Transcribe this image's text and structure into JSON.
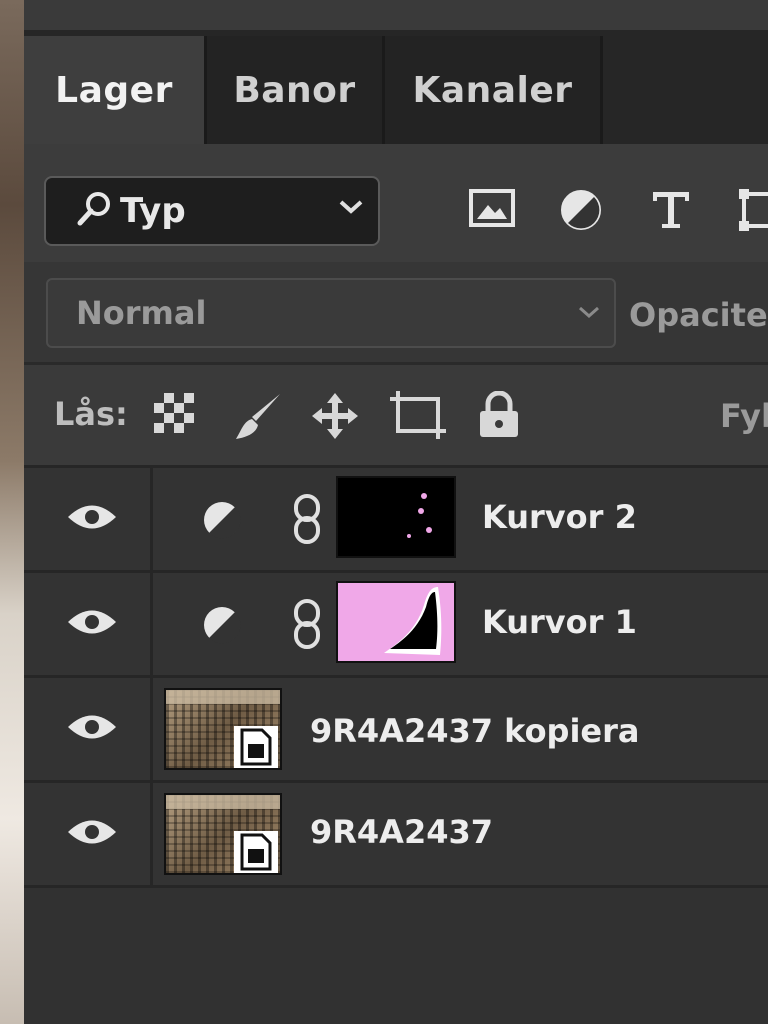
{
  "tabs": [
    {
      "label": "Lager",
      "active": true
    },
    {
      "label": "Banor",
      "active": false
    },
    {
      "label": "Kanaler",
      "active": false
    }
  ],
  "filter": {
    "label": "Typ",
    "icons": [
      "search-icon",
      "chevron-down-icon",
      "image-filter-icon",
      "adjustment-filter-icon",
      "type-filter-icon",
      "shape-filter-icon"
    ]
  },
  "blend": {
    "mode": "Normal",
    "opacity_label": "Opacite"
  },
  "lock": {
    "label": "Lås:",
    "fill_label": "Fyl",
    "icons": [
      "lock-transparent-pixels-icon",
      "lock-image-pixels-icon",
      "lock-position-icon",
      "lock-artboard-icon",
      "lock-all-icon"
    ]
  },
  "layers": [
    {
      "name": "Kurvor 2",
      "kind": "curves-adjustment",
      "visible": true
    },
    {
      "name": "Kurvor 1",
      "kind": "curves-adjustment",
      "visible": true
    },
    {
      "name": "9R4A2437 kopiera",
      "kind": "smart-object",
      "visible": true
    },
    {
      "name": "9R4A2437",
      "kind": "smart-object",
      "visible": true
    }
  ],
  "colors": {
    "panel_bg": "#3b3b3b",
    "mask_pink": "#f0a8e8"
  }
}
